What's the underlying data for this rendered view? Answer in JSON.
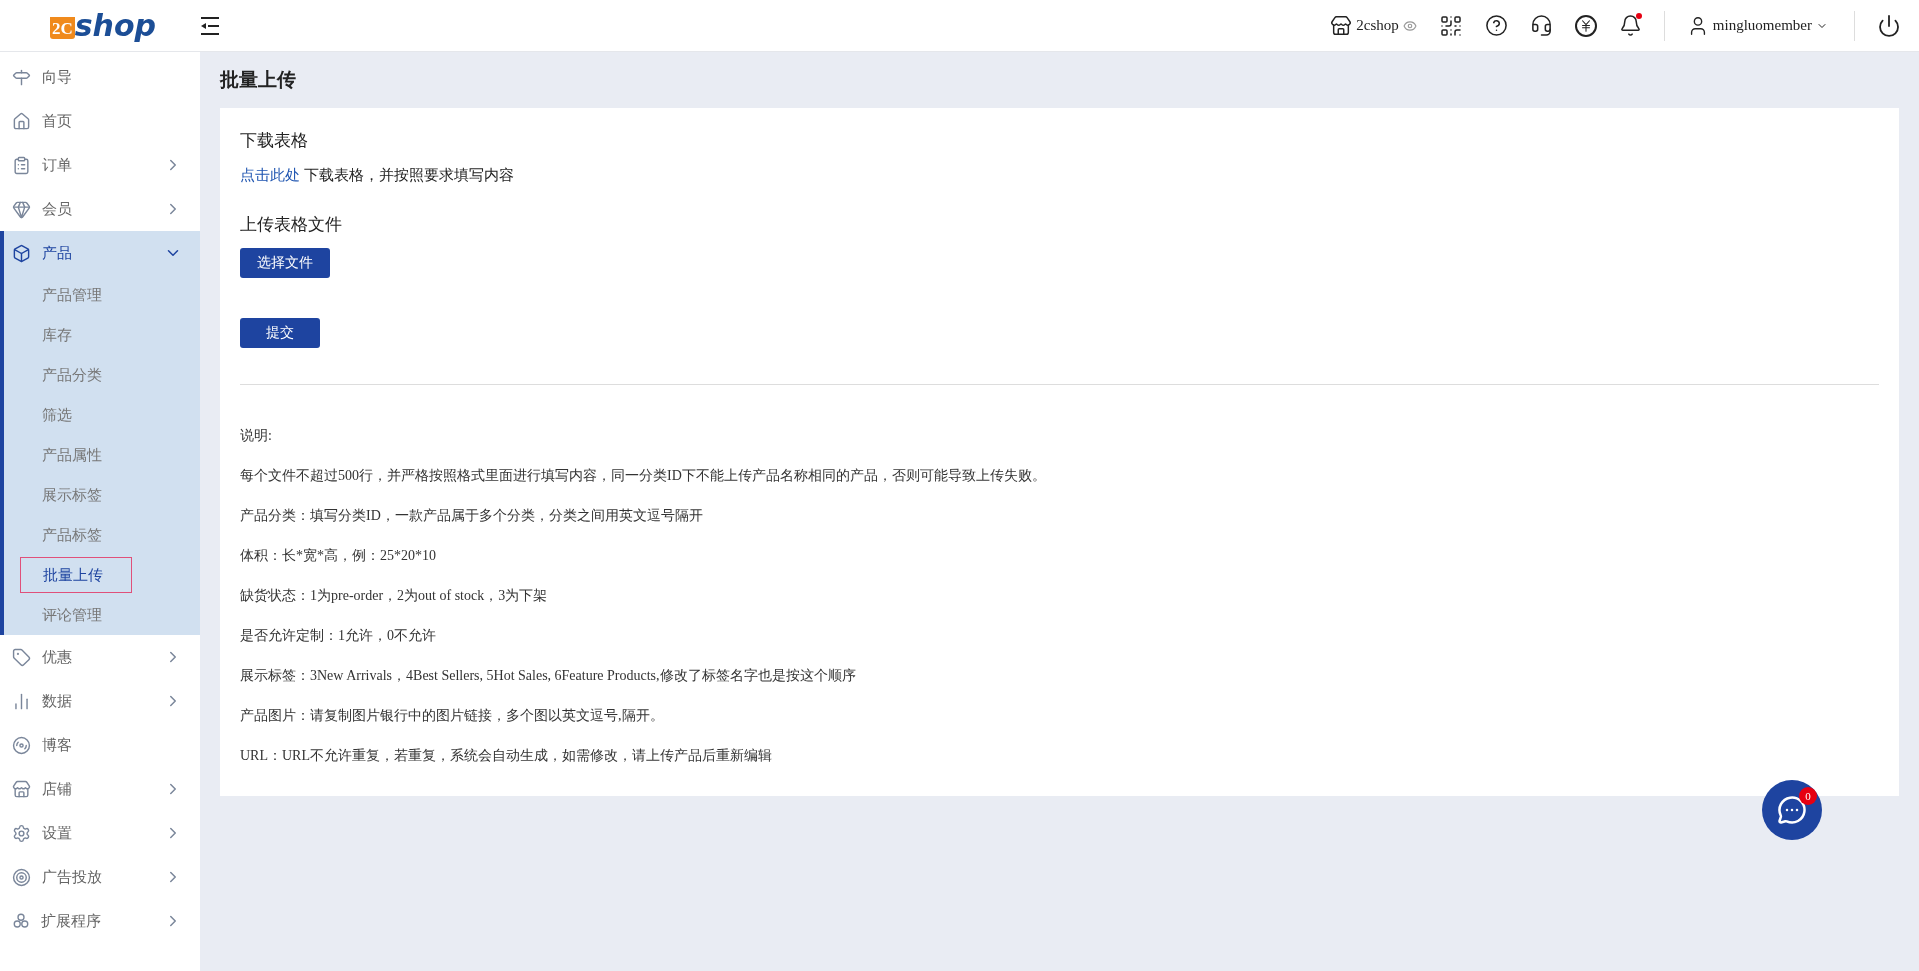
{
  "header": {
    "logo": {
      "mark": "2C",
      "text": "shop"
    },
    "store": "2cshop",
    "notifications_unread": true,
    "user": "mingluomember"
  },
  "sidebar": {
    "items": [
      {
        "label": "向导",
        "expandable": false,
        "expanded": false
      },
      {
        "label": "首页",
        "expandable": false,
        "expanded": false
      },
      {
        "label": "订单",
        "expandable": true,
        "expanded": false
      },
      {
        "label": "会员",
        "expandable": true,
        "expanded": false
      },
      {
        "label": "产品",
        "expandable": true,
        "expanded": true,
        "children": [
          {
            "label": "产品管理",
            "selected": false
          },
          {
            "label": "库存",
            "selected": false
          },
          {
            "label": "产品分类",
            "selected": false
          },
          {
            "label": "筛选",
            "selected": false
          },
          {
            "label": "产品属性",
            "selected": false
          },
          {
            "label": "展示标签",
            "selected": false
          },
          {
            "label": "产品标签",
            "selected": false
          },
          {
            "label": "批量上传",
            "selected": true
          },
          {
            "label": "评论管理",
            "selected": false
          }
        ]
      },
      {
        "label": "优惠",
        "expandable": true,
        "expanded": false
      },
      {
        "label": "数据",
        "expandable": true,
        "expanded": false
      },
      {
        "label": "博客",
        "expandable": false,
        "expanded": false
      },
      {
        "label": "店铺",
        "expandable": true,
        "expanded": false
      },
      {
        "label": "设置",
        "expandable": true,
        "expanded": false
      },
      {
        "label": "广告投放",
        "expandable": true,
        "expanded": false
      },
      {
        "label": "扩展程序",
        "expandable": true,
        "expanded": false
      }
    ]
  },
  "page": {
    "title": "批量上传",
    "download": {
      "heading": "下载表格",
      "link": "点击此处",
      "text": "下载表格，并按照要求填写内容"
    },
    "upload": {
      "heading": "上传表格文件",
      "choose_button": "选择文件",
      "submit_button": "提交"
    },
    "notes": {
      "title": "说明:",
      "lines": [
        "每个文件不超过500行，并严格按照格式里面进行填写内容，同一分类ID下不能上传产品名称相同的产品，否则可能导致上传失败。",
        "产品分类：填写分类ID，一款产品属于多个分类，分类之间用英文逗号隔开",
        "体积：长*宽*高，例：25*20*10",
        "缺货状态：1为pre-order，2为out of stock，3为下架",
        "是否允许定制：1允许，0不允许",
        "展示标签：3New Arrivals，4Best Sellers, 5Hot Sales, 6Feature Products,修改了标签名字也是按这个顺序",
        "产品图片：请复制图片银行中的图片链接，多个图以英文逗号,隔开。",
        "URL：URL不允许重复，若重复，系统会自动生成，如需修改，请上传产品后重新编辑"
      ]
    }
  },
  "chat": {
    "badge": "0"
  }
}
